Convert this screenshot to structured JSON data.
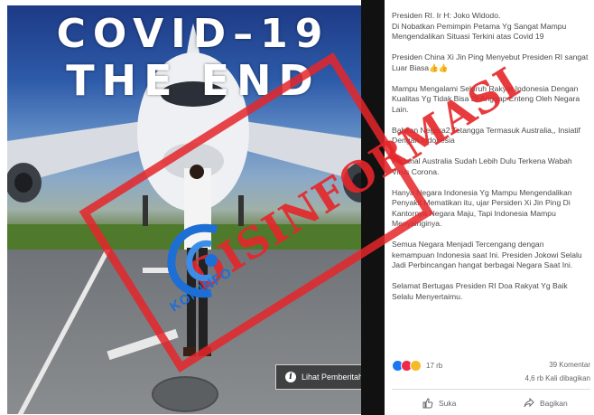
{
  "image": {
    "headline_line1": "COVID–19",
    "headline_line2": "THE END",
    "notice_button_label": "Lihat Pemberitahuan"
  },
  "stamp": {
    "label": "DISINFORMASI",
    "color": "#e5262a"
  },
  "watermark": {
    "label": "KOMINFO",
    "color": "#1d6fd6"
  },
  "post": {
    "paragraphs": [
      "Presiden RI. Ir H: Joko Widodo.\nDi Nobatkan Pemimpin Petama Yg Sangat Mampu Mengendalikan Situasi Terkini atas Covid 19",
      "Presiden China Xi Jin Ping Menyebut Presiden RI sangat Luar Biasa👍👍",
      "Mampu Mengalami Seluruh Rakyat Indonesia Dengan Kualitas Yg Tidak Bisa Di Anggap Enteng Oleh Negara Lain.",
      "Bahkan Negara2 Tetangga Termasuk Australia,, Insiatif Dengan Indonesia",
      "Padahal Australia Sudah Lebih Dulu Terkena Wabah Virus Corona.",
      "Hanya Negara Indonesia Yg Mampu Mengendalikan Penyakit Mematikan itu, ujar Persiden Xi Jin Ping Di Kantornya Negara Maju, Tapi Indonesia Mampu Menyainginya.",
      "Semua Negara Menjadi Tercengang dengan kemampuan Indonesia saat Ini. Presiden Jokowi Selalu Jadi Perbincangan hangat berbagai Negara Saat Ini.",
      "Selamat Bertugas Presiden RI Doa Rakyat Yg Baik Selalu Menyertaimu."
    ],
    "reaction_count": "17 rb",
    "comments": "39 Komentar",
    "shares": "4,6 rb Kali dibagikan",
    "like_label": "Suka",
    "share_label": "Bagikan"
  }
}
